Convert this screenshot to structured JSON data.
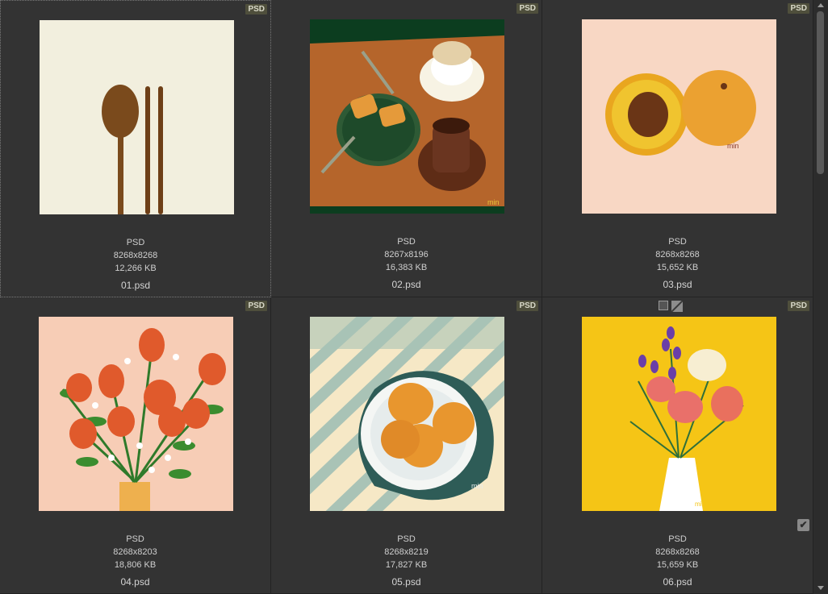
{
  "items": [
    {
      "badge": "PSD",
      "format": "PSD",
      "dims": "8268x8268",
      "size": "12,266 KB",
      "name": "01.psd"
    },
    {
      "badge": "PSD",
      "format": "PSD",
      "dims": "8267x8196",
      "size": "16,383 KB",
      "name": "02.psd"
    },
    {
      "badge": "PSD",
      "format": "PSD",
      "dims": "8268x8268",
      "size": "15,652 KB",
      "name": "03.psd"
    },
    {
      "badge": "PSD",
      "format": "PSD",
      "dims": "8268x8203",
      "size": "18,806 KB",
      "name": "04.psd"
    },
    {
      "badge": "PSD",
      "format": "PSD",
      "dims": "8268x8219",
      "size": "17,827 KB",
      "name": "05.psd"
    },
    {
      "badge": "PSD",
      "format": "PSD",
      "dims": "8268x8268",
      "size": "15,659 KB",
      "name": "06.psd"
    }
  ],
  "colors": {
    "background": "#323232",
    "badge_bg": "#4f4f3c",
    "text": "#cfcfcf"
  },
  "icons": {
    "tile6_tools": [
      "square-icon",
      "slash-icon"
    ],
    "tile6_check": "checkmark-icon",
    "signature": "min"
  }
}
